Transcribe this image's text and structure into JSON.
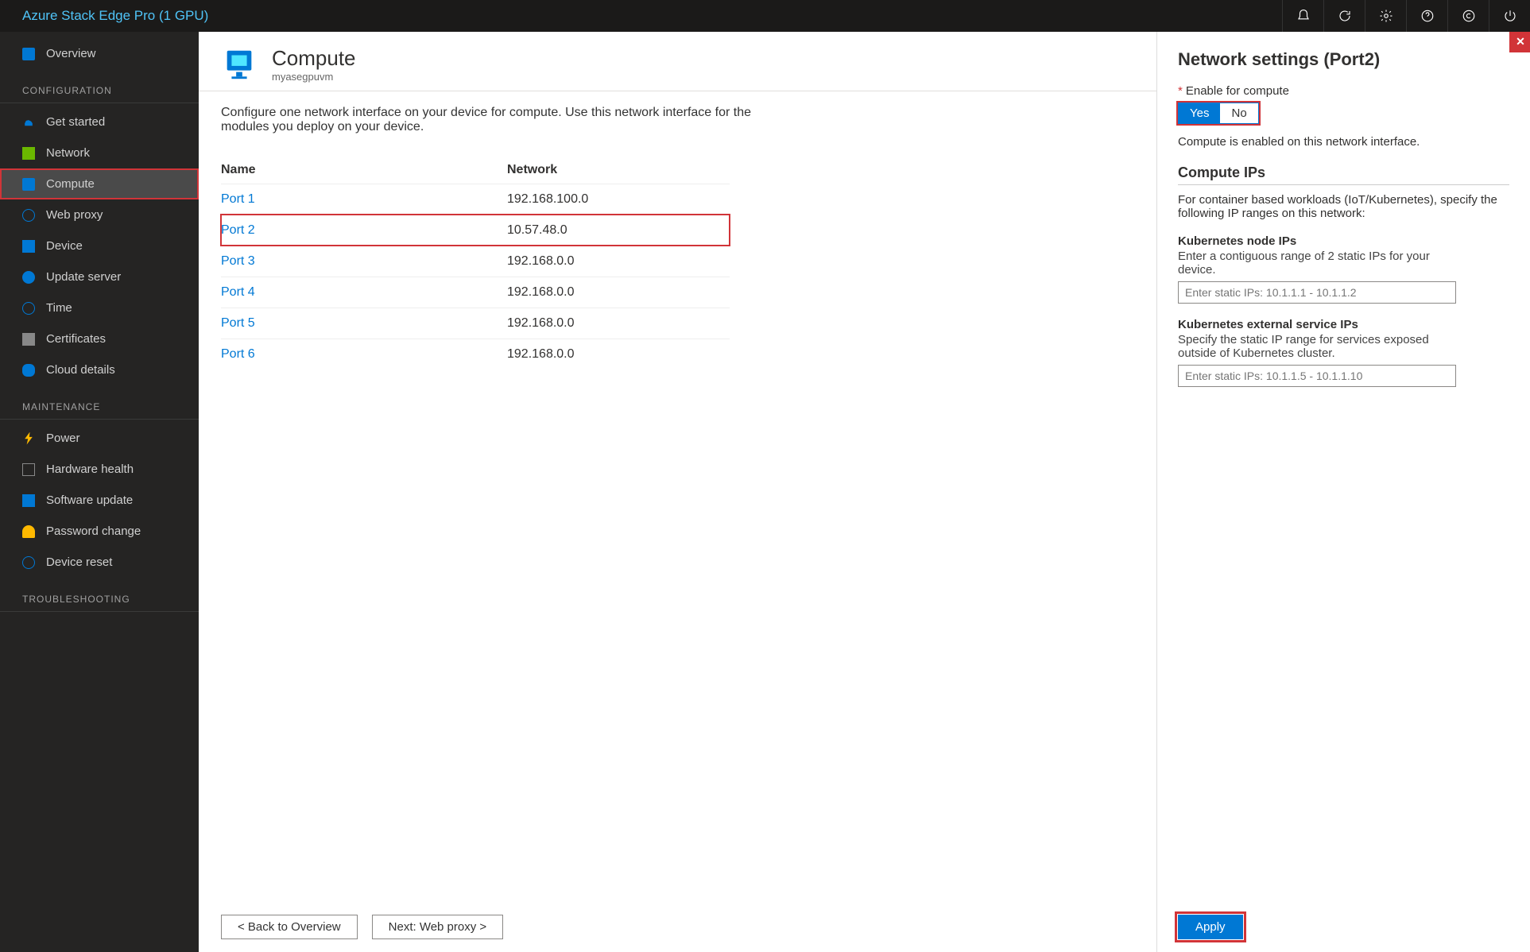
{
  "topbar": {
    "title": "Azure Stack Edge Pro (1 GPU)"
  },
  "sidebar": {
    "overview_label": "Overview",
    "section_config": "CONFIGURATION",
    "items_config": [
      "Get started",
      "Network",
      "Compute",
      "Web proxy",
      "Device",
      "Update server",
      "Time",
      "Certificates",
      "Cloud details"
    ],
    "section_maint": "MAINTENANCE",
    "items_maint": [
      "Power",
      "Hardware health",
      "Software update",
      "Password change",
      "Device reset"
    ],
    "section_trouble": "TROUBLESHOOTING"
  },
  "main": {
    "title": "Compute",
    "subtitle": "myasegpuvm",
    "description": "Configure one network interface on your device for compute. Use this network interface for the modules you deploy on your device.",
    "col_name": "Name",
    "col_network": "Network",
    "ports": [
      {
        "name": "Port 1",
        "net": "192.168.100.0"
      },
      {
        "name": "Port 2",
        "net": "10.57.48.0"
      },
      {
        "name": "Port 3",
        "net": "192.168.0.0"
      },
      {
        "name": "Port 4",
        "net": "192.168.0.0"
      },
      {
        "name": "Port 5",
        "net": "192.168.0.0"
      },
      {
        "name": "Port 6",
        "net": "192.168.0.0"
      }
    ],
    "back_btn": "<  Back to Overview",
    "next_btn": "Next: Web proxy  >"
  },
  "panel": {
    "title": "Network settings (Port2)",
    "enable_label": "Enable for compute",
    "yes": "Yes",
    "no": "No",
    "enabled_msg": "Compute is enabled on this network interface.",
    "compute_ips_title": "Compute IPs",
    "compute_ips_desc": "For container based workloads (IoT/Kubernetes), specify the following IP ranges on this network:",
    "k8s_node_head": "Kubernetes node IPs",
    "k8s_node_sub": "Enter a contiguous range of 2 static IPs for your device.",
    "k8s_node_ph": "Enter static IPs: 10.1.1.1 - 10.1.1.2",
    "k8s_ext_head": "Kubernetes external service IPs",
    "k8s_ext_sub": "Specify the static IP range for services exposed outside of Kubernetes cluster.",
    "k8s_ext_ph": "Enter static IPs: 10.1.1.5 - 10.1.1.10",
    "apply": "Apply"
  }
}
